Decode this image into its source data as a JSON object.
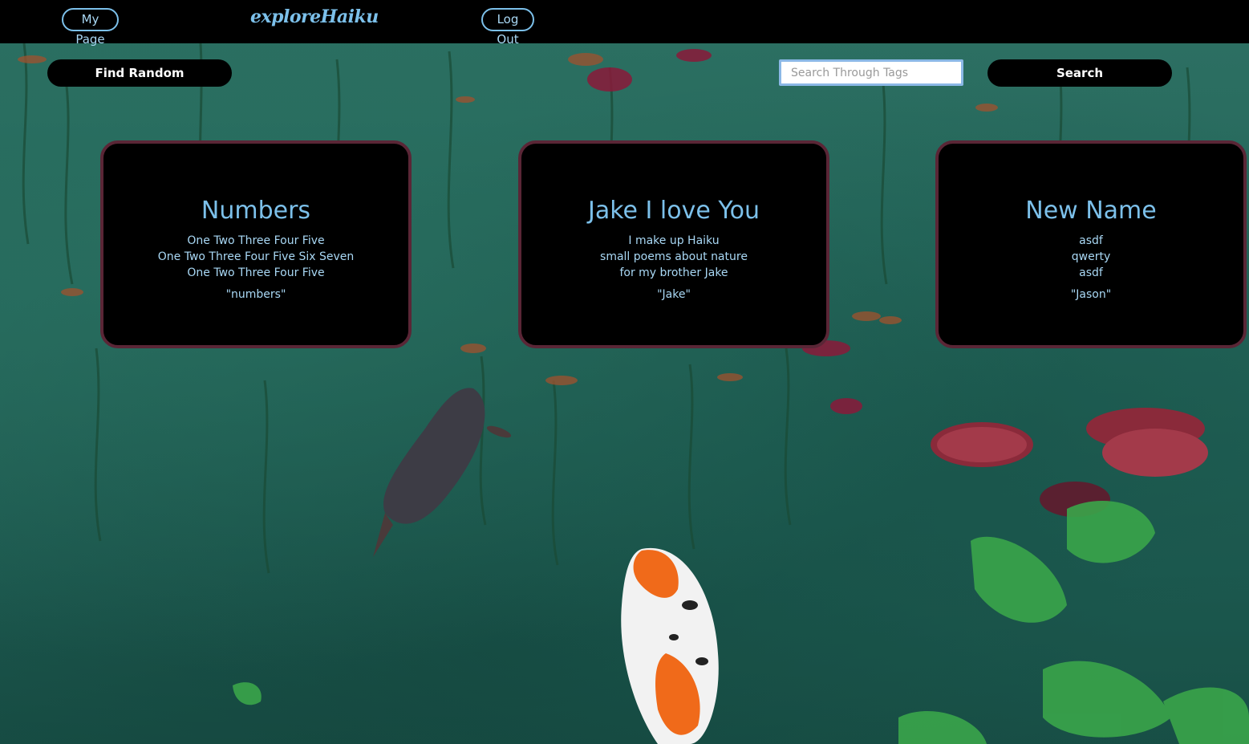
{
  "nav": {
    "my_page": "My Page",
    "brand": "exploreHaiku",
    "log_out": "Log Out"
  },
  "toolbar": {
    "find_random": "Find Random",
    "search_placeholder": "Search Through Tags",
    "search_value": "",
    "search_button": "Search"
  },
  "cards": [
    {
      "title": "Numbers",
      "lines": [
        "One Two Three Four Five",
        "One Two Three Four Five Six Seven",
        "One Two Three Four Five"
      ],
      "tag": "\"numbers\""
    },
    {
      "title": "Jake I love You",
      "lines": [
        "I make up Haiku",
        "small poems about nature",
        "for my brother Jake"
      ],
      "tag": "\"Jake\""
    },
    {
      "title": "New Name",
      "lines": [
        "asdf",
        "qwerty",
        "asdf"
      ],
      "tag": "\"Jason\""
    }
  ],
  "colors": {
    "accent": "#7cc0ea",
    "card_border": "#5a2636",
    "nav_bg": "#000000"
  }
}
